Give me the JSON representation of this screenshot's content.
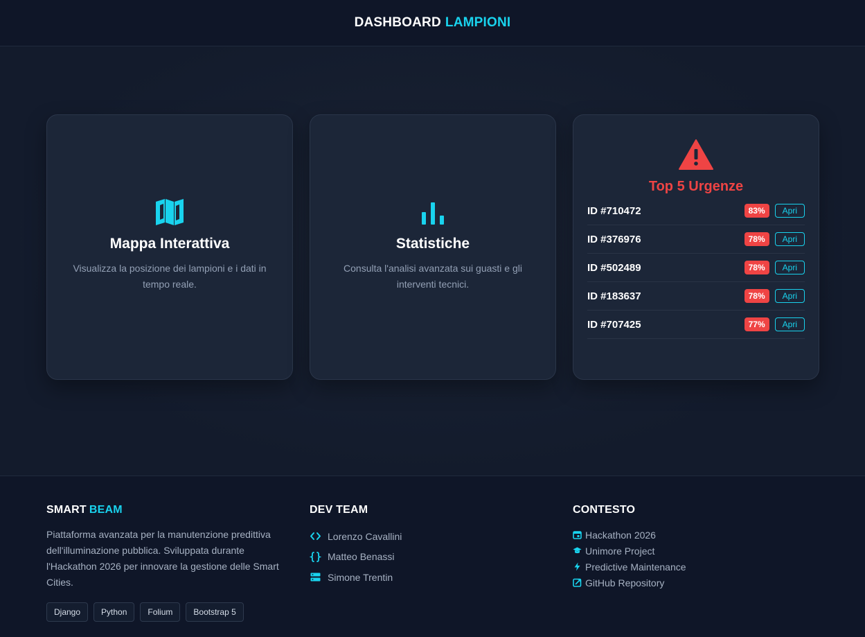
{
  "header": {
    "title_main": "DASHBOARD",
    "title_accent": "LAMPIONI"
  },
  "cards": {
    "map": {
      "icon": "map-icon",
      "title": "Mappa Interattiva",
      "description": "Visualizza la posizione dei lampioni e i dati in tempo reale."
    },
    "stats": {
      "icon": "bar-chart-icon",
      "title": "Statistiche",
      "description": "Consulta l'analisi avanzata sui guasti e gli interventi tecnici."
    },
    "urgencies": {
      "icon": "warning-icon",
      "title": "Top 5 Urgenze",
      "open_label": "Apri",
      "items": [
        {
          "id": "ID #710472",
          "percent": "83%"
        },
        {
          "id": "ID #376976",
          "percent": "78%"
        },
        {
          "id": "ID #502489",
          "percent": "78%"
        },
        {
          "id": "ID #183637",
          "percent": "78%"
        },
        {
          "id": "ID #707425",
          "percent": "77%"
        }
      ]
    }
  },
  "footer": {
    "brand": {
      "main": "SMART",
      "accent": "BEAM"
    },
    "description": "Piattaforma avanzata per la manutenzione predittiva dell'illuminazione pubblica. Sviluppata durante l'Hackathon 2026 per innovare la gestione delle Smart Cities.",
    "tags": [
      "Django",
      "Python",
      "Folium",
      "Bootstrap 5"
    ],
    "team": {
      "title": "DEV TEAM",
      "members": [
        {
          "name": "Lorenzo Cavallini",
          "icon": "code-icon"
        },
        {
          "name": "Matteo Benassi",
          "icon": "braces-icon"
        },
        {
          "name": "Simone Trentin",
          "icon": "server-icon"
        }
      ]
    },
    "context": {
      "title": "CONTESTO",
      "items": [
        {
          "label": "Hackathon 2026",
          "icon": "calendar-icon"
        },
        {
          "label": "Unimore Project",
          "icon": "graduation-cap-icon"
        },
        {
          "label": "Predictive Maintenance",
          "icon": "lightning-icon"
        },
        {
          "label": "GitHub Repository",
          "icon": "external-link-icon"
        }
      ]
    }
  },
  "colors": {
    "accent": "#19d3ee",
    "danger": "#ef4444",
    "background": "#121a2b",
    "card": "#1c2638"
  }
}
